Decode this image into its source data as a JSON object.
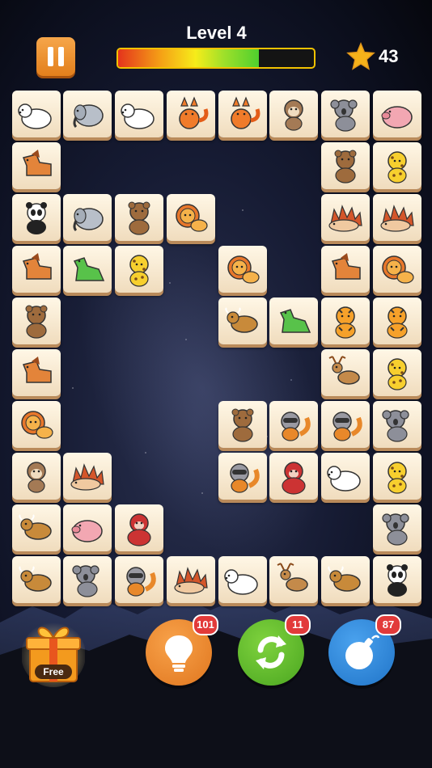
{
  "header": {
    "level_label": "Level 4",
    "progress": 0.72,
    "score": "43"
  },
  "board": {
    "columns": 8,
    "rows": 10,
    "tiles": [
      {
        "row": 0,
        "col": 0,
        "animal": "polar-bear"
      },
      {
        "row": 0,
        "col": 1,
        "animal": "elephant"
      },
      {
        "row": 0,
        "col": 2,
        "animal": "polar-bear"
      },
      {
        "row": 0,
        "col": 3,
        "animal": "fox"
      },
      {
        "row": 0,
        "col": 4,
        "animal": "fox"
      },
      {
        "row": 0,
        "col": 5,
        "animal": "monkey"
      },
      {
        "row": 0,
        "col": 6,
        "animal": "koala"
      },
      {
        "row": 0,
        "col": 7,
        "animal": "pig"
      },
      {
        "row": 1,
        "col": 0,
        "animal": "horse"
      },
      {
        "row": 1,
        "col": 6,
        "animal": "brown-bear"
      },
      {
        "row": 1,
        "col": 7,
        "animal": "leopard"
      },
      {
        "row": 2,
        "col": 0,
        "animal": "panda"
      },
      {
        "row": 2,
        "col": 1,
        "animal": "elephant"
      },
      {
        "row": 2,
        "col": 2,
        "animal": "brown-bear"
      },
      {
        "row": 2,
        "col": 3,
        "animal": "lion"
      },
      {
        "row": 2,
        "col": 6,
        "animal": "hedgehog"
      },
      {
        "row": 2,
        "col": 7,
        "animal": "hedgehog"
      },
      {
        "row": 3,
        "col": 0,
        "animal": "horse"
      },
      {
        "row": 3,
        "col": 1,
        "animal": "dinosaur"
      },
      {
        "row": 3,
        "col": 2,
        "animal": "leopard"
      },
      {
        "row": 3,
        "col": 4,
        "animal": "lion"
      },
      {
        "row": 3,
        "col": 6,
        "animal": "horse"
      },
      {
        "row": 3,
        "col": 7,
        "animal": "lion"
      },
      {
        "row": 4,
        "col": 0,
        "animal": "brown-bear"
      },
      {
        "row": 4,
        "col": 4,
        "animal": "bull"
      },
      {
        "row": 4,
        "col": 5,
        "animal": "dinosaur"
      },
      {
        "row": 4,
        "col": 6,
        "animal": "tiger"
      },
      {
        "row": 4,
        "col": 7,
        "animal": "tiger"
      },
      {
        "row": 5,
        "col": 0,
        "animal": "horse"
      },
      {
        "row": 5,
        "col": 6,
        "animal": "deer"
      },
      {
        "row": 5,
        "col": 7,
        "animal": "leopard"
      },
      {
        "row": 6,
        "col": 0,
        "animal": "lion"
      },
      {
        "row": 6,
        "col": 4,
        "animal": "brown-bear"
      },
      {
        "row": 6,
        "col": 5,
        "animal": "raccoon"
      },
      {
        "row": 6,
        "col": 6,
        "animal": "raccoon"
      },
      {
        "row": 6,
        "col": 7,
        "animal": "koala"
      },
      {
        "row": 7,
        "col": 0,
        "animal": "monkey"
      },
      {
        "row": 7,
        "col": 1,
        "animal": "hedgehog"
      },
      {
        "row": 7,
        "col": 4,
        "animal": "raccoon"
      },
      {
        "row": 7,
        "col": 5,
        "animal": "gorilla"
      },
      {
        "row": 7,
        "col": 6,
        "animal": "polar-bear"
      },
      {
        "row": 7,
        "col": 7,
        "animal": "leopard"
      },
      {
        "row": 8,
        "col": 0,
        "animal": "bull"
      },
      {
        "row": 8,
        "col": 1,
        "animal": "pig"
      },
      {
        "row": 8,
        "col": 2,
        "animal": "gorilla"
      },
      {
        "row": 8,
        "col": 7,
        "animal": "koala"
      },
      {
        "row": 9,
        "col": 0,
        "animal": "bull"
      },
      {
        "row": 9,
        "col": 1,
        "animal": "koala"
      },
      {
        "row": 9,
        "col": 2,
        "animal": "raccoon"
      },
      {
        "row": 9,
        "col": 3,
        "animal": "hedgehog"
      },
      {
        "row": 9,
        "col": 4,
        "animal": "polar-bear"
      },
      {
        "row": 9,
        "col": 5,
        "animal": "deer"
      },
      {
        "row": 9,
        "col": 6,
        "animal": "bull"
      },
      {
        "row": 9,
        "col": 7,
        "animal": "panda"
      }
    ]
  },
  "footer": {
    "gift_label": "Free",
    "hint_count": "101",
    "shuffle_count": "11",
    "bomb_count": "87"
  },
  "colors": {
    "tile_face": "#fff7e6",
    "hint": "#f0882a",
    "shuffle": "#5fbf2e",
    "bomb": "#2f8ce0",
    "badge": "#e23a3a"
  },
  "icons": {
    "pause": "pause-icon",
    "star": "star-icon",
    "gift": "gift-icon",
    "hint": "lightbulb-icon",
    "shuffle": "shuffle-icon",
    "bomb": "bomb-icon"
  }
}
